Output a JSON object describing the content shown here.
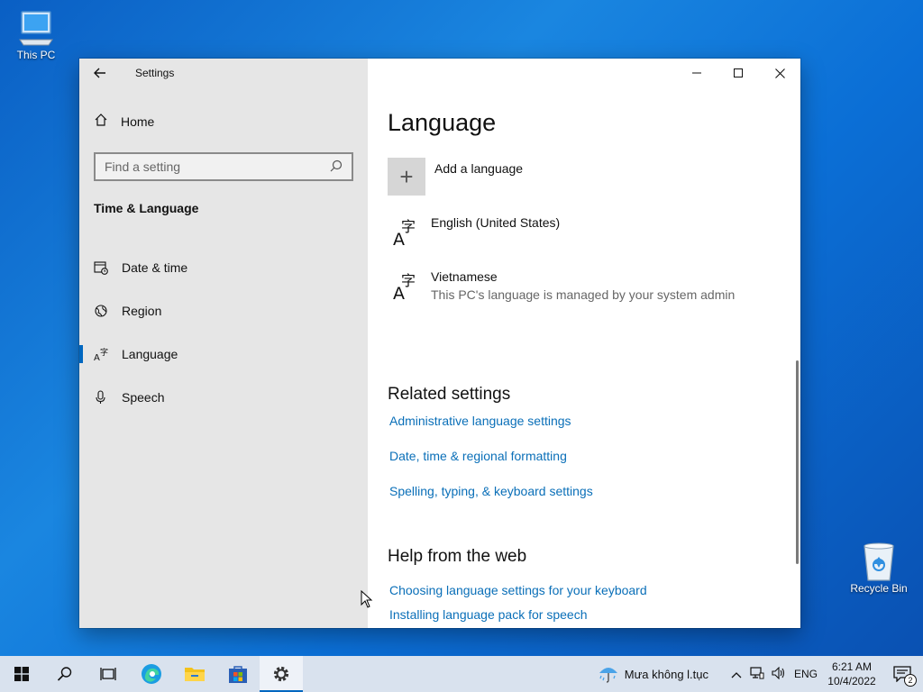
{
  "desktop": {
    "this_pc_label": "This PC",
    "recycle_bin_label": "Recycle Bin"
  },
  "window": {
    "app_title": "Settings",
    "home_label": "Home",
    "search_placeholder": "Find a setting",
    "section_title": "Time & Language",
    "nav": [
      {
        "label": "Date & time",
        "icon": "calendar-clock-icon"
      },
      {
        "label": "Region",
        "icon": "globe-icon"
      },
      {
        "label": "Language",
        "icon": "language-icon",
        "active": true
      },
      {
        "label": "Speech",
        "icon": "microphone-icon"
      }
    ]
  },
  "main": {
    "title": "Language",
    "add_language": "Add a language",
    "languages": [
      {
        "name": "English (United States)",
        "note": ""
      },
      {
        "name": "Vietnamese",
        "note": "This PC's language is managed by your system admin"
      }
    ],
    "related_title": "Related settings",
    "related_links": [
      "Administrative language settings",
      "Date, time & regional formatting",
      "Spelling, typing, & keyboard settings"
    ],
    "help_title": "Help from the web",
    "help_links": [
      "Choosing language settings for your keyboard",
      "Installing language pack for speech"
    ]
  },
  "taskbar": {
    "weather_text": "Mưa không l.tục",
    "language_indicator": "ENG",
    "time": "6:21 AM",
    "date": "10/4/2022",
    "notification_count": "2"
  },
  "colors": {
    "accent": "#0067c0",
    "link": "#0a6fb8",
    "sidebar_bg": "#e6e6e6"
  }
}
